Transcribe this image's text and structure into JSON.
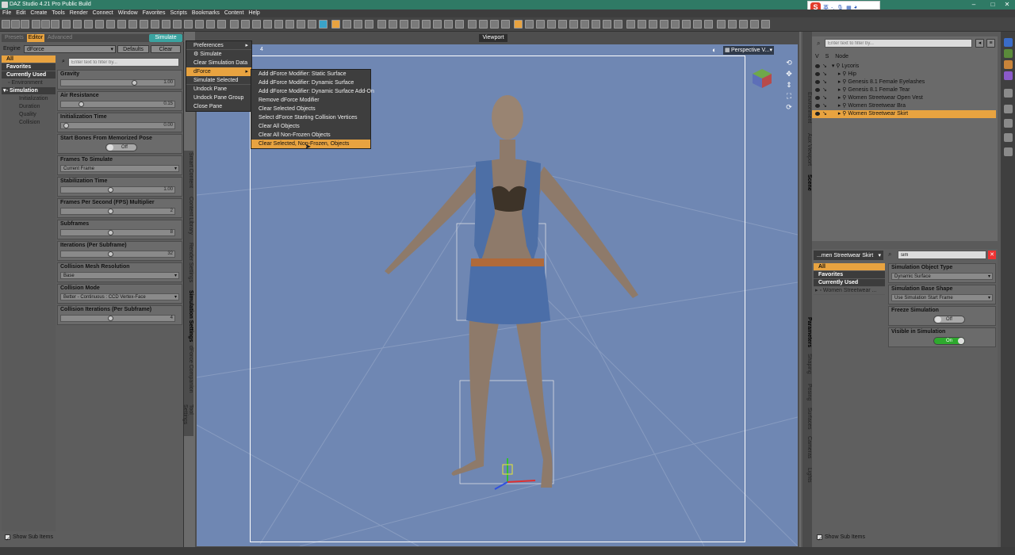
{
  "window": {
    "title": "DAZ Studio 4.21 Pro Public Build"
  },
  "ime": {
    "logo": "S",
    "label": "英"
  },
  "menubar": [
    "File",
    "Edit",
    "Create",
    "Tools",
    "Render",
    "Connect",
    "Window",
    "Favorites",
    "Scripts",
    "Bookmarks",
    "Content",
    "Help"
  ],
  "left_panel": {
    "tabs": {
      "presets": "Presets",
      "editor": "Editor",
      "advanced": "Advanced"
    },
    "simulate_button": "Simulate",
    "engine_label": "Engine",
    "engine_value": "dForce",
    "defaults_button": "Defaults",
    "clear_button": "Clear",
    "categories": {
      "all": "All",
      "favorites": "Favorites",
      "currently_used": "Currently Used",
      "environment": "Environment",
      "simulation": "Simulation",
      "initialization": "Initialization",
      "duration": "Duration",
      "quality": "Quality",
      "collision": "Collision"
    },
    "filter_placeholder": "Enter text to filter by...",
    "properties": [
      {
        "name": "Gravity",
        "kind": "slider",
        "value": "1.00",
        "pos": 0.62
      },
      {
        "name": "Air Resistance",
        "kind": "slider",
        "value": "0.15",
        "pos": 0.15
      },
      {
        "name": "Initialization Time",
        "kind": "slider",
        "value": "0.00",
        "pos": 0.0
      },
      {
        "name": "Start Bones From Memorized Pose",
        "kind": "toggle",
        "value": "Off"
      },
      {
        "name": "Frames To Simulate",
        "kind": "dropdown",
        "value": "Current Frame"
      },
      {
        "name": "Stabilization Time",
        "kind": "slider",
        "value": "1.00",
        "pos": 0.44
      },
      {
        "name": "Frames Per Second (FPS) Multiplier",
        "kind": "slider",
        "value": "2",
        "pos": 0.44
      },
      {
        "name": "Subframes",
        "kind": "slider",
        "value": "8",
        "pos": 0.44
      },
      {
        "name": "Iterations (Per Subframe)",
        "kind": "slider",
        "value": "32",
        "pos": 0.44
      },
      {
        "name": "Collision Mesh Resolution",
        "kind": "dropdown",
        "value": "Base"
      },
      {
        "name": "Collision Mode",
        "kind": "dropdown",
        "value": "Better - Continuous : CCD Vertex-Face"
      },
      {
        "name": "Collision Iterations (Per Subframe)",
        "kind": "slider",
        "value": "4",
        "pos": 0.44
      }
    ],
    "side_tabs": [
      "Smart Content",
      "Content Library",
      "Render Settings",
      "Simulation Settings",
      "dForce Companion",
      "Tool Settings"
    ],
    "show_sub_items": "Show Sub Items"
  },
  "viewport": {
    "title": "Viewport",
    "camera": "Perspective V...",
    "frame_number": "4"
  },
  "context_menu": {
    "items": [
      {
        "label": "Preferences",
        "submenu": true
      },
      {
        "label": "Simulate",
        "icon": true
      },
      {
        "label": "Clear Simulation Data"
      },
      {
        "label": "dForce",
        "submenu": true,
        "highlight": true
      },
      {
        "label": "Simulate Selected"
      },
      {
        "label": "Undock Pane"
      },
      {
        "label": "Undock Pane Group"
      },
      {
        "label": "Close Pane"
      }
    ]
  },
  "dforce_submenu": {
    "items": [
      "Add dForce Modifier: Static Surface",
      "Add dForce Modifier: Dynamic Surface",
      "Add dForce Modifier: Dynamic Surface Add-On",
      "Remove dForce Modifier",
      "Clear Selected Objects",
      "Select dForce Starting Collision Vertices",
      "Clear All Objects",
      "Clear All Non-Frozen Objects",
      "Clear Selected, Non-Frozen, Objects"
    ],
    "highlighted_index": 8
  },
  "scene_panel": {
    "filter_placeholder": "Enter text to filter by...",
    "col_v": "V",
    "col_s": "S",
    "col_node": "Node",
    "nodes": [
      {
        "label": "Lycoris",
        "indent": 0
      },
      {
        "label": "Hip",
        "indent": 1
      },
      {
        "label": "Genesis 8.1 Female Eyelashes",
        "indent": 1
      },
      {
        "label": "Genesis 8.1 Female Tear",
        "indent": 1
      },
      {
        "label": "Women Streetwear Open Vest",
        "indent": 1
      },
      {
        "label": "Women Streetwear Bra",
        "indent": 1
      },
      {
        "label": "Women Streetwear Skirt",
        "indent": 1,
        "selected": true
      }
    ],
    "side_tabs": [
      "Environment",
      "Aux Viewport",
      "Scene"
    ]
  },
  "parameters_panel": {
    "node_select": "...men Streetwear Skirt",
    "search_value": "sim",
    "categories": {
      "all": "All",
      "favorites": "Favorites",
      "currently_used": "Currently Used",
      "node": "Women Streetwear ..."
    },
    "properties": [
      {
        "name": "Simulation Object Type",
        "kind": "dropdown",
        "value": "Dynamic Surface"
      },
      {
        "name": "Simulation Base Shape",
        "kind": "dropdown",
        "value": "Use Simulation Start Frame"
      },
      {
        "name": "Freeze Simulation",
        "kind": "toggle",
        "value": "Off"
      },
      {
        "name": "Visible in Simulation",
        "kind": "toggle",
        "value": "On"
      }
    ],
    "side_tabs": [
      "Parameters",
      "Shaping",
      "Posing",
      "Surfaces",
      "Cameras",
      "Lights"
    ],
    "show_sub_items": "Show Sub Items"
  },
  "colors": {
    "accent": "#e8a340",
    "titlebar": "#2f7a65",
    "viewport_bg": "#6f87b3",
    "toggle_on": "#2ea92e"
  }
}
